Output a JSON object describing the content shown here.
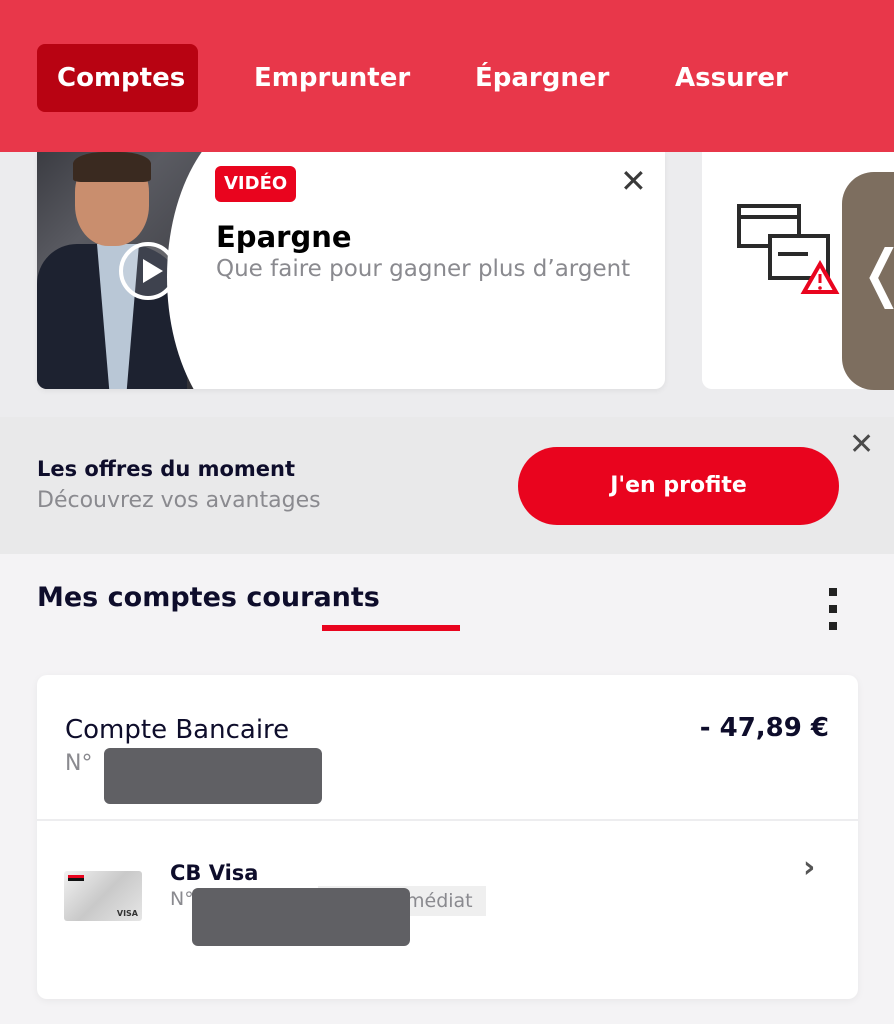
{
  "nav": {
    "tabs": [
      {
        "label": "Comptes",
        "active": true
      },
      {
        "label": "Emprunter",
        "active": false
      },
      {
        "label": "Épargner",
        "active": false
      },
      {
        "label": "Assurer",
        "active": false
      }
    ]
  },
  "carousel": {
    "video_card": {
      "badge": "VIDÉO",
      "title": "Epargne",
      "subtitle": "Que faire pour gagner plus d’argent",
      "close": "✕",
      "icons": [
        "play-icon",
        "close-icon"
      ]
    },
    "second_card": {
      "icon": "cards-warning-icon"
    },
    "handle_icon": "chevron-left-icon",
    "handle_glyph": "❬"
  },
  "offers": {
    "title": "Les offres du moment",
    "subtitle": "Découvrez vos avantages",
    "button": "J'en profite",
    "close": "✕"
  },
  "accounts": {
    "section_title": "Mes comptes courants",
    "menu_icon": "more-vertical-icon",
    "account": {
      "name": "Compte Bancaire",
      "number_label": "N°",
      "balance": "- 47,89 €"
    },
    "card": {
      "name": "CB Visa",
      "number_label": "N°",
      "debit_tag": "médiat",
      "visa_label": "VISA",
      "chevron": "›"
    }
  },
  "colors": {
    "nav_bg": "#e8374a",
    "nav_active": "#b80312",
    "accent_red": "#e9041e",
    "text_dark": "#0e0d2b",
    "text_grey": "#8a8a8f"
  }
}
